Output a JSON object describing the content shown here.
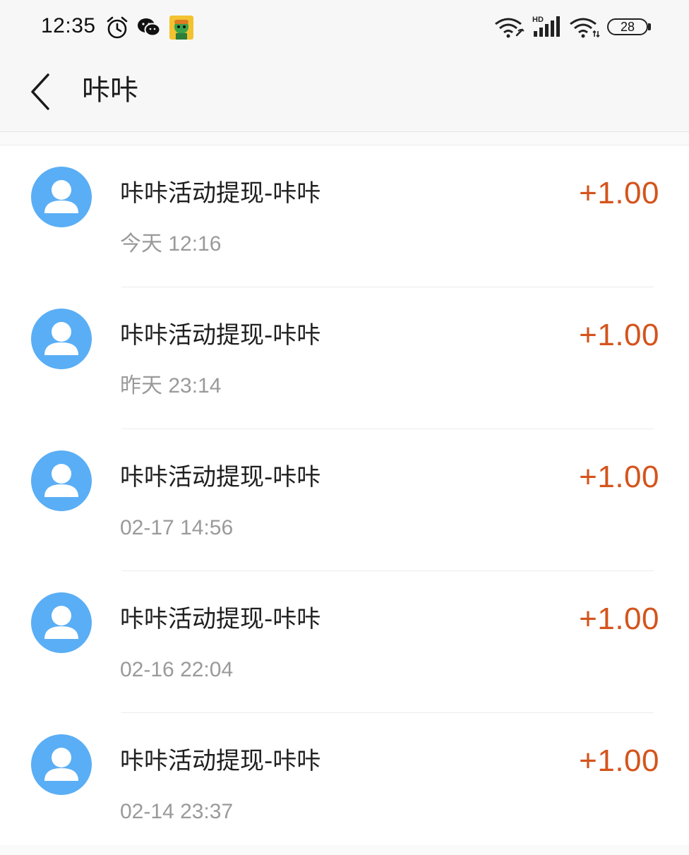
{
  "status_bar": {
    "time": "12:35",
    "battery": "28",
    "icons": [
      "alarm-clock-icon",
      "wechat-icon",
      "app-avatar-icon",
      "wifi-link-icon",
      "hd-signal-icon",
      "wifi-icon",
      "battery-icon"
    ]
  },
  "nav": {
    "title": "咔咔",
    "back_icon": "back-chevron-icon"
  },
  "colors": {
    "amount": "#d4541c",
    "avatar_bg": "#5aaef5",
    "title_text": "#1f1f1f",
    "time_text": "#9a9a9a"
  },
  "transactions": [
    {
      "title": "咔咔活动提现-咔咔",
      "time": "今天  12:16",
      "amount": "+1.00",
      "avatar_icon": "user-avatar-icon"
    },
    {
      "title": "咔咔活动提现-咔咔",
      "time": "昨天  23:14",
      "amount": "+1.00",
      "avatar_icon": "user-avatar-icon"
    },
    {
      "title": "咔咔活动提现-咔咔",
      "time": "02-17  14:56",
      "amount": "+1.00",
      "avatar_icon": "user-avatar-icon"
    },
    {
      "title": "咔咔活动提现-咔咔",
      "time": "02-16  22:04",
      "amount": "+1.00",
      "avatar_icon": "user-avatar-icon"
    },
    {
      "title": "咔咔活动提现-咔咔",
      "time": "02-14  23:37",
      "amount": "+1.00",
      "avatar_icon": "user-avatar-icon"
    }
  ]
}
